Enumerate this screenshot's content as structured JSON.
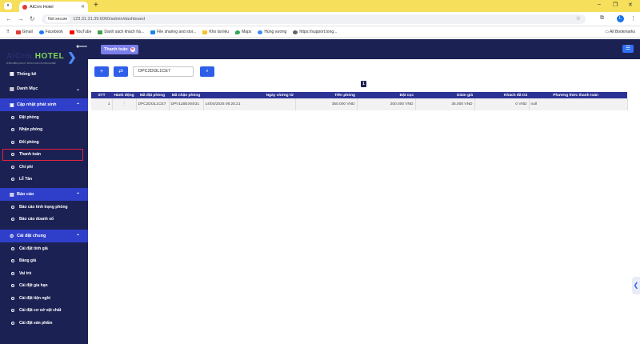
{
  "browser": {
    "tab_title": "AiCrm Hotel",
    "tab_close": "✕",
    "new_tab": "+",
    "secure_label": "Not secure",
    "url": "123.31.31.39:6060/admin/dashboard",
    "profile_initial": "L",
    "bookmarks": [
      {
        "label": "Gmail",
        "color": "#e53935"
      },
      {
        "label": "Facebook",
        "color": "#1877f2"
      },
      {
        "label": "YouTube",
        "color": "#ff0000"
      },
      {
        "label": "Danh sách khách hà...",
        "color": "#43a047"
      },
      {
        "label": "File sharing and stor...",
        "color": "#1e88e5"
      },
      {
        "label": "Kho tài liệu",
        "color": "#fbc02d"
      },
      {
        "label": "Maps",
        "color": "#34a853"
      },
      {
        "label": "Hùng vương",
        "color": "#4285f4"
      },
      {
        "label": "https://support.tong...",
        "color": "#5f6368"
      }
    ],
    "all_bookmarks": "All Bookmarks"
  },
  "sidebar": {
    "logo_prefix": "AiCrm",
    "logo_hotel": "HOTEL",
    "logo_tagline": "PHẦN MỀM QUẢN LÝ KHÁCH SẠN CHUYÊN NGHIỆP",
    "top_partial": "Thống kê",
    "danh_muc": "Danh Mục",
    "cap_nhat": "Cập nhật phát sinh",
    "cap_nhat_items": [
      "Đặt phòng",
      "Nhận phòng",
      "Đổi phòng",
      "Thanh toán",
      "Chi phí",
      "Lễ Tân"
    ],
    "bao_cao": "Báo cáo",
    "bao_cao_items": [
      "Báo cáo tình trạng phòng",
      "Báo cáo doanh số"
    ],
    "cai_dat": "Cài đặt chung",
    "cai_dat_items": [
      "Cài đặt tính giá",
      "Bảng giá",
      "Vai trò",
      "Cài đặt gia hạn",
      "Cài đặt tiện nghi",
      "Cài đặt cơ sở vật chất",
      "Cài đặt sản phẩm"
    ]
  },
  "main": {
    "page_tab": "Thanh toán",
    "search_value": "DPC2DI3L1CE7",
    "page_number": "1",
    "columns": [
      "STT",
      "Hành động",
      "Mã đặt phòng",
      "Mã nhận phòng",
      "Ngày chứng từ",
      "Tiền phòng",
      "Đặt cọc",
      "Giảm giá",
      "Khách đã trả",
      "Phương thức thanh toán"
    ],
    "rows": [
      {
        "stt": "1",
        "action": "⋮",
        "booking_code": "DPC2DI3L1CE7",
        "checkin_code": "DPV11BEX8X31",
        "date": "14/04/2025 09:25:21",
        "room_fee": "350.000 VND",
        "deposit": "200.000 VND",
        "discount": "35.000 VND",
        "paid": "0 VND",
        "method": "null"
      }
    ]
  },
  "colors": {
    "sidebar_bg": "#1c2154",
    "group_active": "#2f3fc9",
    "primary": "#2f5fe9",
    "highlight_border": "#e0243b"
  }
}
